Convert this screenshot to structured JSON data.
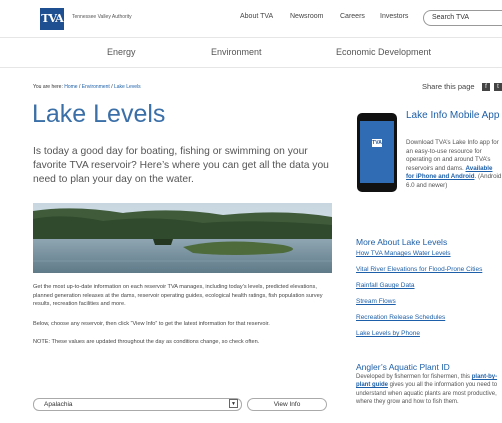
{
  "header": {
    "logo": "TVA",
    "org_name": "Tennessee Valley Authority",
    "nav": [
      "About TVA",
      "Newsroom",
      "Careers",
      "Investors"
    ],
    "search_placeholder": "Search TVA"
  },
  "main_nav": [
    "Energy",
    "Environment",
    "Economic Development"
  ],
  "breadcrumb": {
    "prefix": "You are here:",
    "items": [
      "Home",
      "Environment",
      "Lake Levels"
    ],
    "separator": "/"
  },
  "share_label": "Share this page",
  "social_icons": [
    "facebook-icon",
    "twitter-icon"
  ],
  "page_title": "Lake Levels",
  "intro": "Is today a good day for boating, fishing or swimming on your favorite TVA reservoir? Here’s where you can get all the data you need to plan your day on the water.",
  "paragraphs": [
    "Get the most up-to-date information on each reservoir TVA manages, including today’s levels, predicted elevations, planned generation releases at the dams, reservoir operating guides, ecological health ratings, fish population survey results, recreation facilities and more.",
    "Below, choose any reservoir, then click “View Info” to get the latest information for that reservoir.",
    "NOTE: These values are updated throughout the day as conditions change, so check often."
  ],
  "reservoir_select": {
    "value": "Apalachia"
  },
  "view_info_label": "View Info",
  "mobile_app": {
    "phone_logo": "TVA",
    "title": "Lake Info Mobile App",
    "desc_before": "Download TVA’s Lake Info app for an easy-to-use resource for operating on and around TVA’s reservoirs and dams.",
    "link": "Available for iPhone and Android",
    "desc_after": ". (Android 6.0 and newer)"
  },
  "more_about": {
    "heading": "More About Lake Levels",
    "links": [
      "How TVA Manages Water Levels",
      "Vital River Elevations for Flood-Prone Cities",
      "Rainfall Gauge Data",
      "Stream Flows",
      "Recreation Release Schedules",
      "Lake Levels by Phone"
    ]
  },
  "anglers": {
    "heading": "Angler’s Aquatic Plant ID",
    "text_before": "Developed by fishermen for fishermen, this",
    "link": "plant-by-plant guide",
    "text_after": "gives you all the information you need to understand when aquatic plants are most productive, where they grow and how to fish them."
  }
}
